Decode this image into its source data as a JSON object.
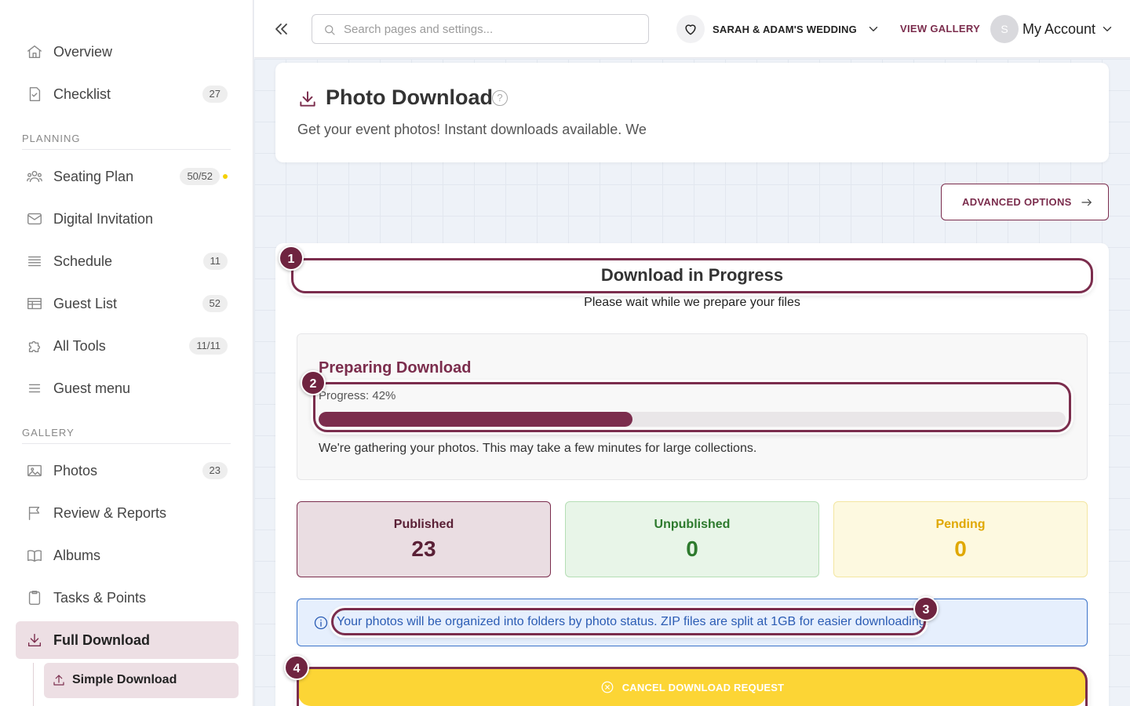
{
  "sidebar": {
    "items": [
      {
        "label": "Overview",
        "icon": "home-icon"
      },
      {
        "label": "Checklist",
        "count": "27",
        "icon": "checklist-icon"
      },
      {
        "label": "Seating Plan",
        "count": "50/52",
        "icon": "people-icon",
        "status_dot_color": "#f4d000"
      },
      {
        "label": "Digital Invitation",
        "icon": "mail-icon"
      },
      {
        "label": "Schedule",
        "count": "11",
        "icon": "schedule-icon"
      },
      {
        "label": "Guest List",
        "count": "52",
        "icon": "table-icon"
      },
      {
        "label": "All Tools",
        "count": "11/11",
        "icon": "puzzle-icon"
      },
      {
        "label": "Guest menu",
        "icon": "menu-icon"
      },
      {
        "label": "Photos",
        "count": "23",
        "icon": "image-icon"
      },
      {
        "label": "Review & Reports",
        "icon": "flag-icon"
      },
      {
        "label": "Albums",
        "icon": "book-icon"
      },
      {
        "label": "Tasks & Points",
        "icon": "clipboard-icon"
      },
      {
        "label": "Full Download",
        "icon": "download-icon",
        "active": true
      }
    ],
    "sections": {
      "planning": "PLANNING",
      "gallery": "GALLERY"
    },
    "sub_item": {
      "label": "Simple Download",
      "icon": "upload-icon"
    }
  },
  "topbar": {
    "search_placeholder": "Search pages and settings...",
    "event_name": "SARAH & ADAM'S WEDDING",
    "view_gallery": "VIEW GALLERY",
    "avatar_initial": "S",
    "account_label": "My Account"
  },
  "header": {
    "title": "Photo Download",
    "help": "?",
    "subtitle": "Get your event photos! Instant downloads available. We"
  },
  "advanced_options_label": "ADVANCED OPTIONS",
  "download": {
    "title": "Download in Progress",
    "subtitle": "Please wait while we prepare your files",
    "preparing_title": "Preparing Download",
    "progress_label": "Progress: 42%",
    "progress_fraction": 0.42,
    "note": "We're gathering your photos. This may take a few minutes for large collections."
  },
  "stats": {
    "published": {
      "label": "Published",
      "value": "23"
    },
    "unpublished": {
      "label": "Unpublished",
      "value": "0"
    },
    "pending": {
      "label": "Pending",
      "value": "0"
    }
  },
  "info_text": "Your photos will be organized into folders by photo status. ZIP files are split at 1GB for easier downloading.",
  "cancel_label": "CANCEL DOWNLOAD REQUEST",
  "annotations": [
    "1",
    "2",
    "3",
    "4"
  ],
  "colors": {
    "accent": "#7b2d4d",
    "warning": "#fcd535",
    "info": "#2b5cb4",
    "success": "#2d7a2d"
  }
}
